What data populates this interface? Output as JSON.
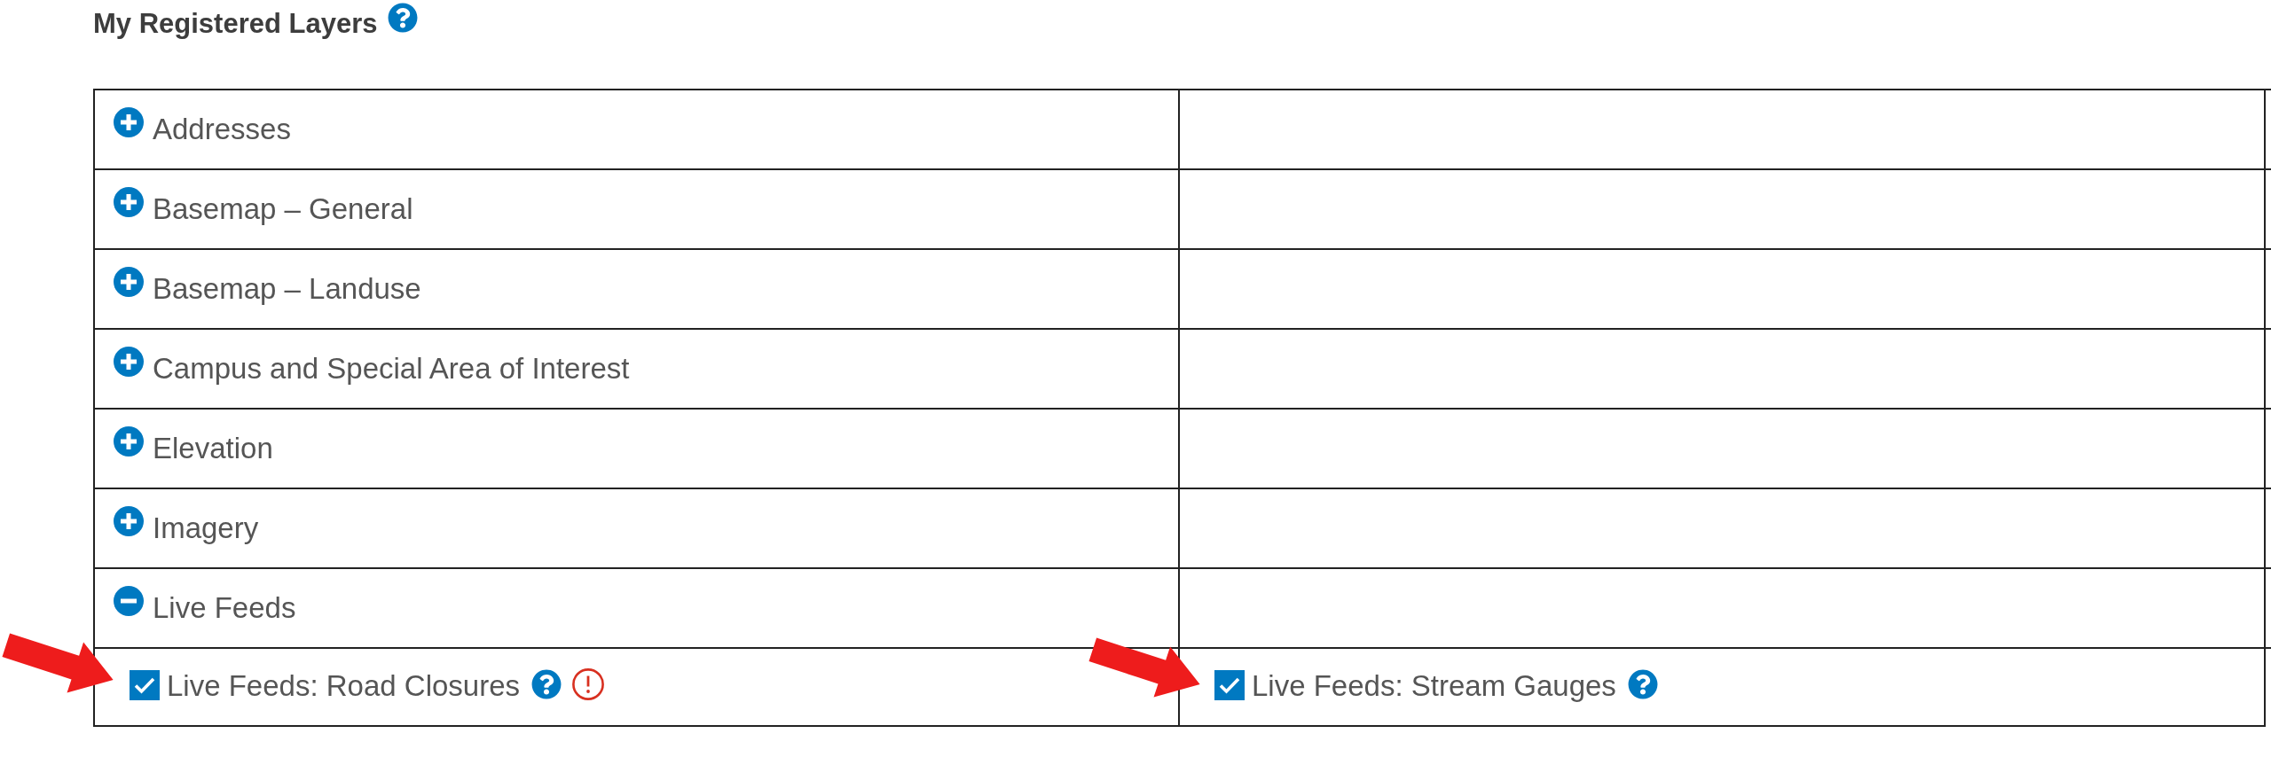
{
  "section": {
    "title": "My Registered Layers"
  },
  "table": {
    "rows": [
      {
        "cells": [
          {
            "kind": "group",
            "label": "Addresses",
            "expanded": false
          }
        ]
      },
      {
        "cells": [
          {
            "kind": "group",
            "label": "Basemap – General",
            "expanded": false
          }
        ]
      },
      {
        "cells": [
          {
            "kind": "group",
            "label": "Basemap – Landuse",
            "expanded": false
          }
        ]
      },
      {
        "cells": [
          {
            "kind": "group",
            "label": "Campus and Special Area of Interest",
            "expanded": false
          }
        ]
      },
      {
        "cells": [
          {
            "kind": "group",
            "label": "Elevation",
            "expanded": false
          }
        ]
      },
      {
        "cells": [
          {
            "kind": "group",
            "label": "Imagery",
            "expanded": false
          }
        ]
      },
      {
        "cells": [
          {
            "kind": "group",
            "label": "Live Feeds",
            "expanded": true
          }
        ]
      },
      {
        "cells": [
          {
            "kind": "layer",
            "label": "Live Feeds: Road Closures",
            "checked": true,
            "help": true,
            "warning": true
          },
          {
            "kind": "layer",
            "label": "Live Feeds: Stream Gauges",
            "checked": true,
            "help": true,
            "warning": false
          }
        ]
      }
    ]
  }
}
